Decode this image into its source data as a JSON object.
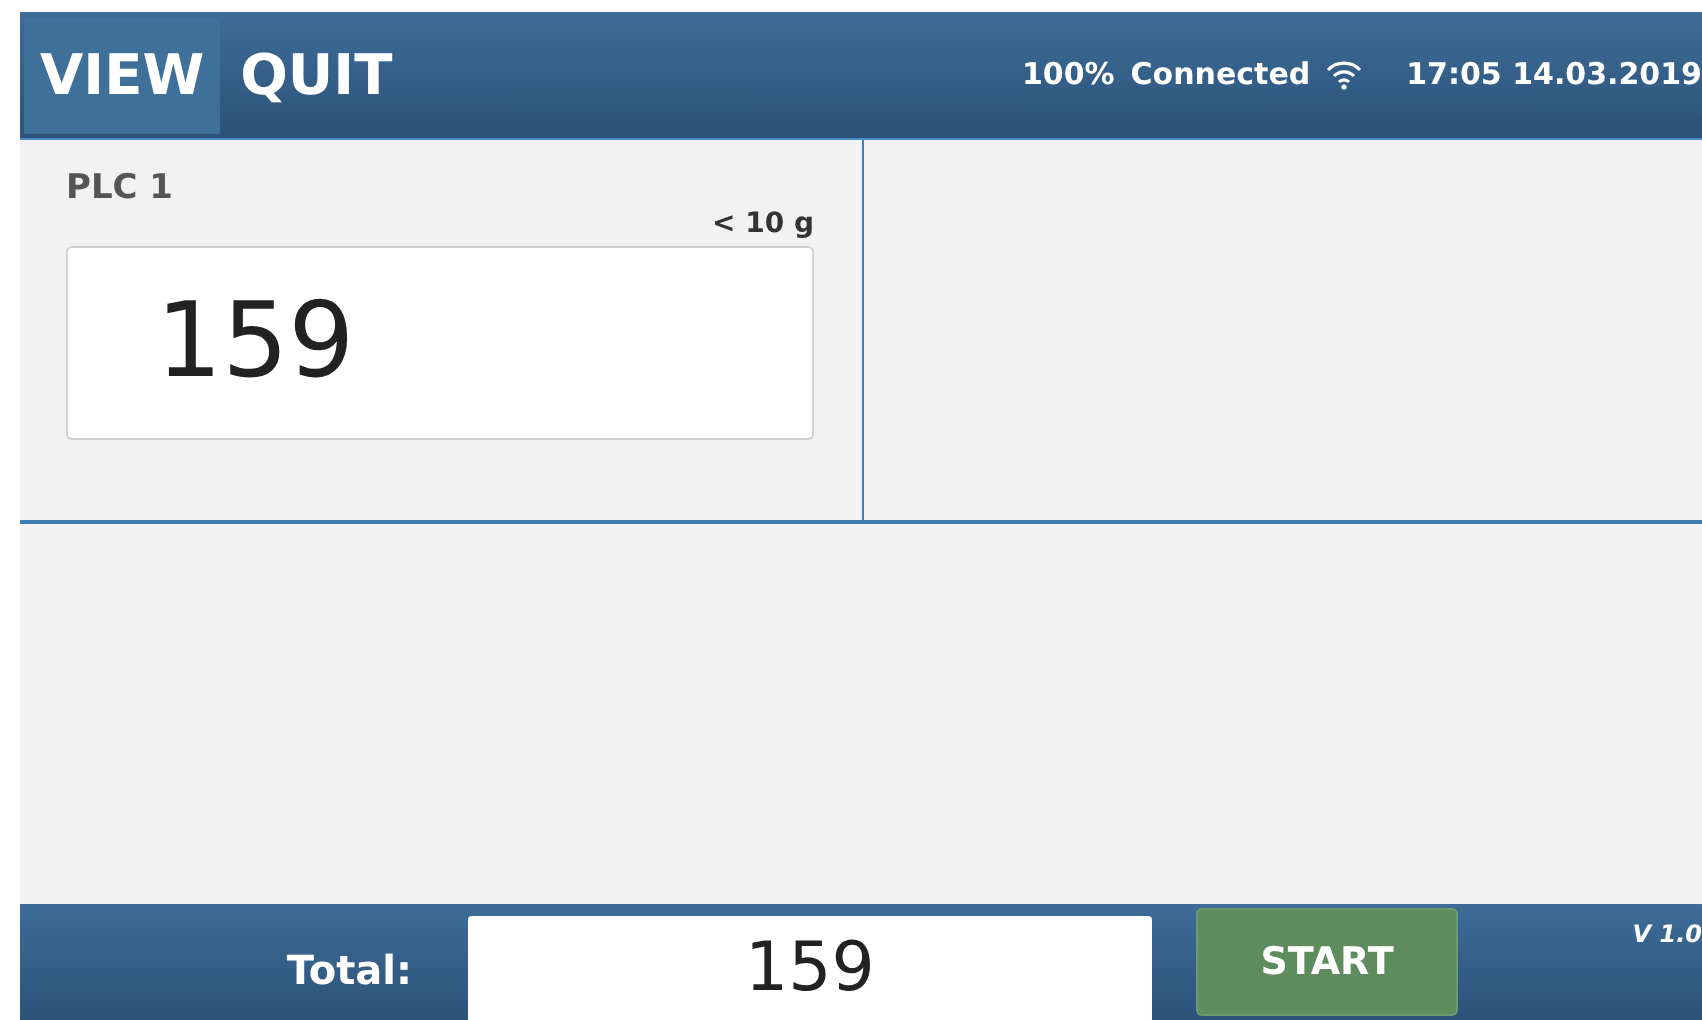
{
  "menu": [
    {
      "label": "VIEW",
      "selected": true
    },
    {
      "label": "QUIT",
      "selected": false
    }
  ],
  "status": {
    "battery": "100%",
    "connection": "Connected",
    "datetime": "17:05 14.03.2019"
  },
  "plcs": [
    {
      "name": "PLC 1",
      "tolerance": "< 10 g",
      "value": "159"
    }
  ],
  "footer": {
    "total_label": "Total:",
    "total_value": "159",
    "start_button": "START",
    "version": "V 1.0"
  }
}
